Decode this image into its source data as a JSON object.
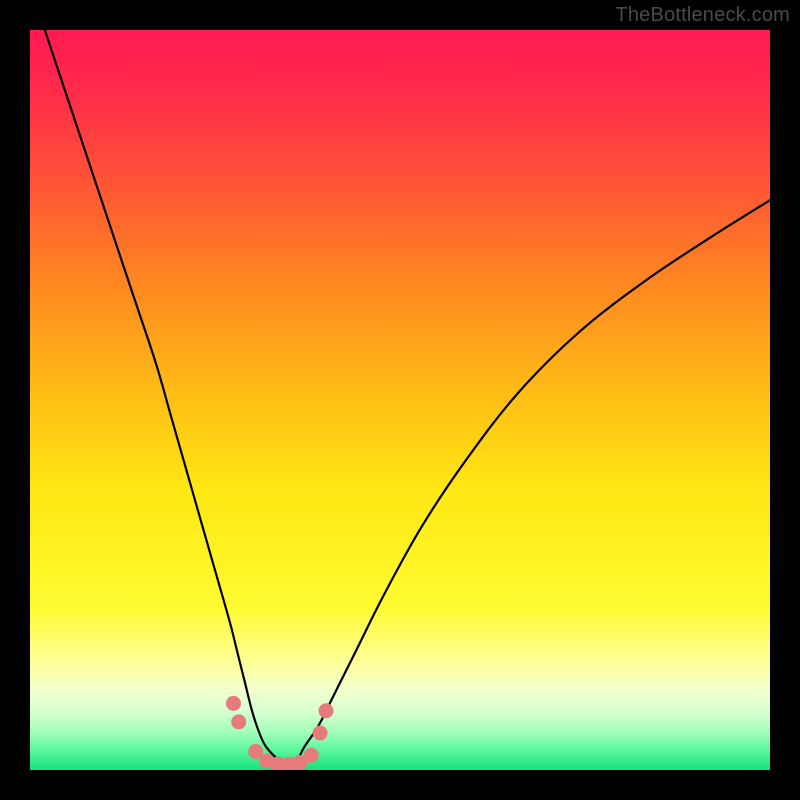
{
  "watermark": "TheBottleneck.com",
  "colors": {
    "frame": "#000000",
    "gradient_stops": [
      {
        "offset": 0.0,
        "color": "#ff1a52"
      },
      {
        "offset": 0.08,
        "color": "#ff2a4c"
      },
      {
        "offset": 0.2,
        "color": "#ff5236"
      },
      {
        "offset": 0.35,
        "color": "#ff8a20"
      },
      {
        "offset": 0.5,
        "color": "#ffc015"
      },
      {
        "offset": 0.62,
        "color": "#ffe713"
      },
      {
        "offset": 0.78,
        "color": "#fffb30"
      },
      {
        "offset": 0.86,
        "color": "#fdffa0"
      },
      {
        "offset": 0.89,
        "color": "#f2ffcc"
      },
      {
        "offset": 0.92,
        "color": "#d8ffd0"
      },
      {
        "offset": 0.95,
        "color": "#a0ffb8"
      },
      {
        "offset": 0.975,
        "color": "#55f59a"
      },
      {
        "offset": 1.0,
        "color": "#18e07d"
      }
    ],
    "curve": "#000000",
    "marker_fill": "#e77b7b",
    "marker_stroke": "#d95f5f"
  },
  "chart_data": {
    "type": "line",
    "title": "",
    "xlabel": "",
    "ylabel": "",
    "xlim": [
      0,
      100
    ],
    "ylim": [
      0,
      100
    ],
    "series": [
      {
        "name": "bottleneck-curve",
        "x": [
          2,
          5,
          8,
          11,
          14,
          17,
          19,
          21,
          23,
          25,
          27,
          28,
          29,
          30,
          31,
          32,
          34,
          35,
          36,
          37,
          39,
          41,
          44,
          48,
          53,
          59,
          66,
          74,
          83,
          92,
          100
        ],
        "values": [
          100,
          91,
          82,
          73,
          64,
          55,
          48,
          41,
          34,
          27,
          20,
          16,
          12,
          8,
          5,
          3,
          1,
          0.5,
          1,
          3,
          6,
          10,
          16,
          24,
          33,
          42,
          51,
          59,
          66,
          72,
          77
        ]
      }
    ],
    "markers": {
      "name": "highlighted-points",
      "x": [
        27.5,
        28.2,
        30.5,
        32.0,
        33.5,
        35.0,
        36.5,
        38.0,
        39.2,
        40.0
      ],
      "values": [
        9.0,
        6.5,
        2.5,
        1.2,
        0.8,
        0.8,
        1.0,
        2.0,
        5.0,
        8.0
      ]
    }
  }
}
